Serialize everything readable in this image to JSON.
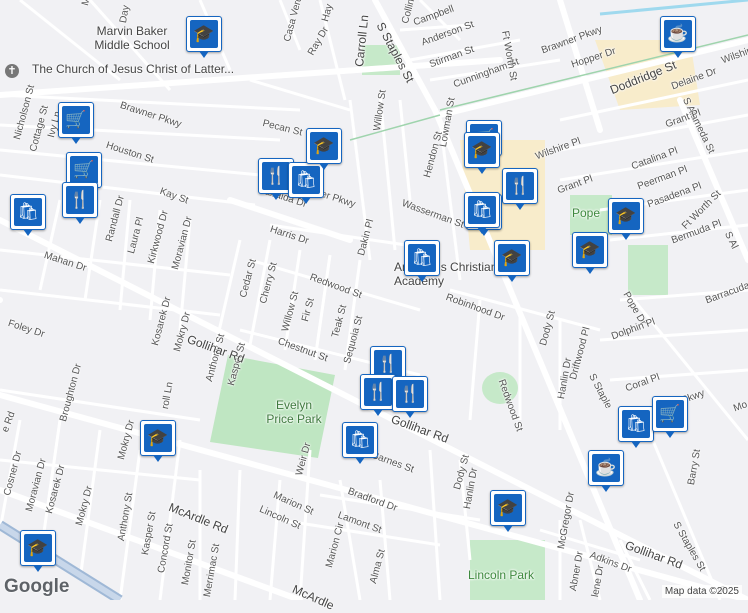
{
  "map": {
    "attribution": "Map data ©2025",
    "logo": "Google",
    "parks": [
      "Evelyn Price Park",
      "Lincoln Park",
      "Pope"
    ],
    "places": {
      "school_marvin": "Marvin Baker Middle School",
      "church": "The Church of Jesus Christ of Latter...",
      "academy": "Annapolis Christian Academy"
    },
    "streets": [
      "Mc",
      "Day",
      "Hay",
      "Casa Verde",
      "Carroll Ln",
      "Collins",
      "Campbell",
      "Anderson St",
      "Stirman St",
      "Cunningham St",
      "Ft Worth St",
      "Brawner Pkwy",
      "Hopper Dr",
      "S Staples St",
      "S Alameda St",
      "Doddridge St",
      "Delaine Dr",
      "Wilshire",
      "Ray Dr",
      "Nicholson St",
      "Cottage St",
      "Ivy Ln",
      "Houston St",
      "Pecan St",
      "Willow St",
      "Lowman St",
      "Grant Pl",
      "Wilshire Pl",
      "Hendon St",
      "Catalina Pl",
      "Peerman Pl",
      "Pasadena Pl",
      "Kay St",
      "Randall Dr",
      "Laura Pl",
      "Kirkwood Dr",
      "Moravian Dr",
      "Dalraida Dr",
      "Brawner Pkwy",
      "Dakin Pl",
      "Wasserman St",
      "Harris Dr",
      "Bermuda Pl",
      "Ft Worth St",
      "Mahan Dr",
      "Cedar St",
      "Cherry St",
      "Willow St",
      "Fir St",
      "Redwood St",
      "Robinhood Dr",
      "Barracuda",
      "Pope Dr",
      "Foley Dr",
      "Kosarek Dr",
      "Mokry Dr",
      "Anthony St",
      "Kasper St",
      "Chestnut St",
      "Teak St",
      "Sequoia St",
      "Dody St",
      "Dolphin Pl",
      "Gollihar Rd",
      "Hanlin Dr",
      "Driftwood Pl",
      "Coral Pl",
      "S Staples St",
      "Broughton Dr",
      "Mokry Dr",
      "Weir Dr",
      "Barnes St",
      "Redwood St",
      "Barry St",
      "Cosner Dr",
      "Moravian Dr",
      "Kosarek Dr",
      "Mokry Dr",
      "McArdle Rd",
      "Marion St",
      "Bradford Dr",
      "Dody St",
      "Hanlin Dr",
      "Gollihar Rd",
      "Anthony St",
      "Kasper St",
      "Concord St",
      "Monitor St",
      "Merrimac St",
      "Lincoln St",
      "Lamont St",
      "Marion Cir",
      "Alma St",
      "McArdle",
      "McGregor Dr",
      "Adkins Dr",
      "Abner Dr",
      "S Staples St",
      "Pkwy",
      "Mo"
    ]
  },
  "pins": [
    {
      "name": "school-pin-marvin-baker",
      "icon": "graduation-cap-icon",
      "glyph": "🎓"
    },
    {
      "name": "cafe-pin-doddridge",
      "icon": "coffee-cup-icon",
      "glyph": "☕"
    },
    {
      "name": "shopping-cart-pin-ivy",
      "icon": "shopping-cart-icon",
      "glyph": "🛒"
    },
    {
      "name": "shopping-cart-pin-houston",
      "icon": "shopping-cart-icon",
      "glyph": "🛒"
    },
    {
      "name": "shopping-bag-pin-west",
      "icon": "shopping-bag-icon",
      "glyph": "🛍"
    },
    {
      "name": "restaurant-pin-west",
      "icon": "fork-knife-icon",
      "glyph": "🍴"
    },
    {
      "name": "restaurant-pin-pecan",
      "icon": "fork-knife-icon",
      "glyph": "🍴"
    },
    {
      "name": "shopping-bag-pin-pecan",
      "icon": "shopping-bag-icon",
      "glyph": "🛍"
    },
    {
      "name": "school-pin-willow",
      "icon": "graduation-cap-icon",
      "glyph": "🎓"
    },
    {
      "name": "shopping-cart-pin-staples",
      "icon": "shopping-cart-icon",
      "glyph": "🛒"
    },
    {
      "name": "school-pin-staples",
      "icon": "graduation-cap-icon",
      "glyph": "🎓"
    },
    {
      "name": "restaurant-pin-staples",
      "icon": "fork-knife-icon",
      "glyph": "🍴"
    },
    {
      "name": "shopping-bag-pin-staples",
      "icon": "shopping-bag-icon",
      "glyph": "🛍"
    },
    {
      "name": "shopping-bag-pin-wasserman",
      "icon": "shopping-bag-icon",
      "glyph": "🛍"
    },
    {
      "name": "shopping-bag-pin-academy",
      "icon": "shopping-bag-icon",
      "glyph": "🛍"
    },
    {
      "name": "school-pin-academy",
      "icon": "graduation-cap-icon",
      "glyph": "🎓"
    },
    {
      "name": "school-pin-pope",
      "icon": "graduation-cap-icon",
      "glyph": "🎓"
    },
    {
      "name": "school-pin-pope-2",
      "icon": "graduation-cap-icon",
      "glyph": "🎓"
    },
    {
      "name": "restaurant-pin-sequoia",
      "icon": "fork-knife-icon",
      "glyph": "🍴"
    },
    {
      "name": "restaurant-pin-sequoia-2",
      "icon": "fork-knife-icon",
      "glyph": "🍴"
    },
    {
      "name": "restaurant-pin-gollihar",
      "icon": "fork-knife-icon",
      "glyph": "🍴"
    },
    {
      "name": "shopping-bag-pin-barnes",
      "icon": "shopping-bag-icon",
      "glyph": "🛍"
    },
    {
      "name": "school-pin-mokry",
      "icon": "graduation-cap-icon",
      "glyph": "🎓"
    },
    {
      "name": "shopping-bag-pin-coral",
      "icon": "shopping-bag-icon",
      "glyph": "🛍"
    },
    {
      "name": "shopping-cart-pin-coral",
      "icon": "shopping-cart-icon",
      "glyph": "🛒"
    },
    {
      "name": "cafe-pin-staples-south",
      "icon": "coffee-cup-icon",
      "glyph": "☕"
    },
    {
      "name": "school-pin-hanlin",
      "icon": "graduation-cap-icon",
      "glyph": "🎓"
    },
    {
      "name": "school-pin-mcardle",
      "icon": "graduation-cap-icon",
      "glyph": "🎓"
    }
  ]
}
